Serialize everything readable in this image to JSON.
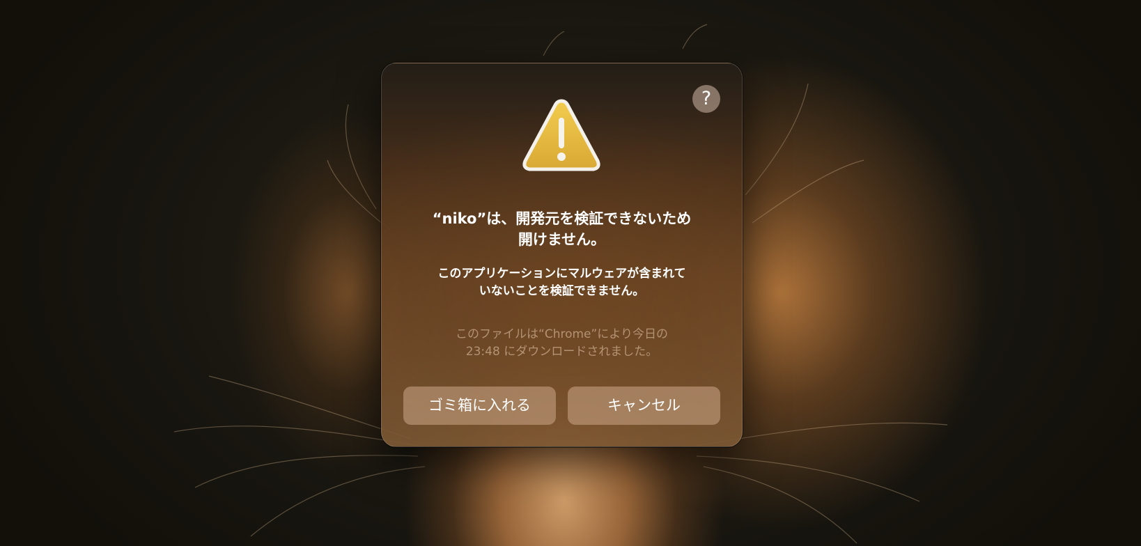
{
  "wallpaper": {
    "subject": "hamster-wallpaper"
  },
  "dialog": {
    "help_label": "?",
    "icon": "warning-triangle-icon",
    "title": "“niko”は、開発元を検証できないため\n開けません。",
    "message": "このアプリケーションにマルウェアが含まれて\nいないことを検証できません。",
    "info": "このファイルは“Chrome”により今日の\n23:48 にダウンロードされました。",
    "buttons": {
      "move_to_trash": "ゴミ箱に入れる",
      "cancel": "キャンセル"
    }
  },
  "colors": {
    "warning_yellow": "#e2b33a",
    "button_fill": "#c4a080"
  }
}
